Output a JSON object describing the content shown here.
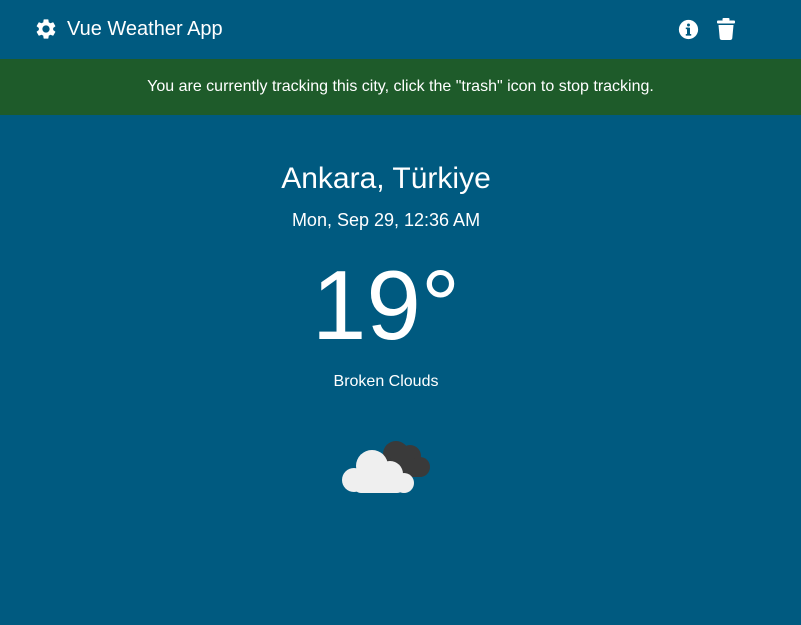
{
  "header": {
    "app_title": "Vue Weather App",
    "settings_icon": "gear-icon",
    "info_icon": "info-icon",
    "trash_icon": "trash-icon"
  },
  "banner": {
    "message": "You are currently tracking this city, click the \"trash\" icon to stop tracking.",
    "color": "#1e5b2a"
  },
  "weather": {
    "city": "Ankara, Türkiye",
    "datetime": "Mon, Sep 29, 12:36 AM",
    "temperature": "19°",
    "condition": "Broken Clouds",
    "condition_icon": "broken-clouds-icon"
  },
  "colors": {
    "background": "#005a80",
    "text": "#ffffff"
  }
}
